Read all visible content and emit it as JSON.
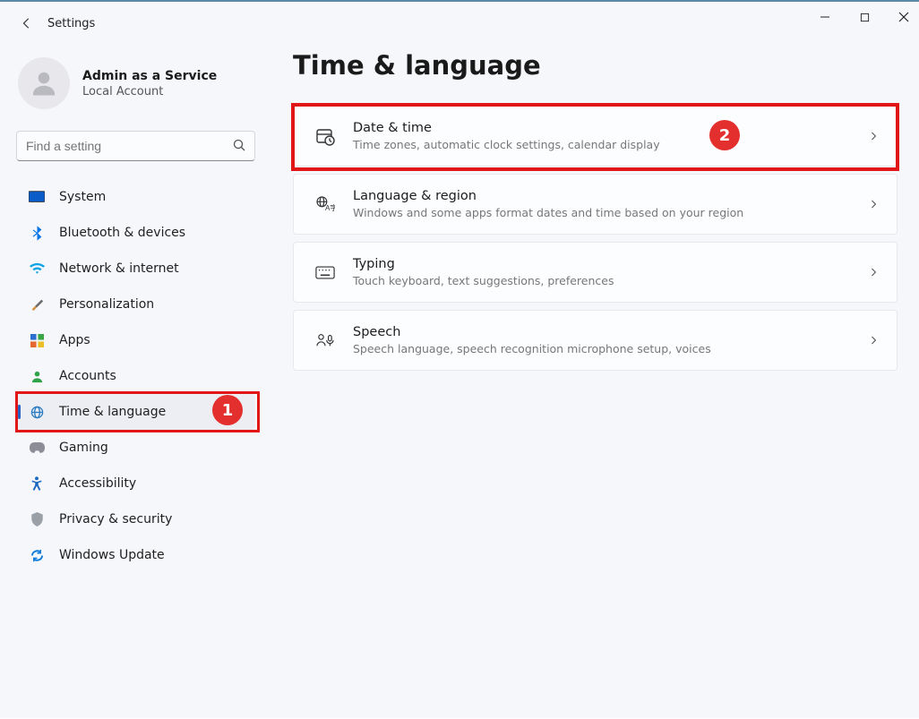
{
  "titlebar": {
    "label": "Settings"
  },
  "user": {
    "name": "Admin as a Service",
    "sub": "Local Account"
  },
  "search": {
    "placeholder": "Find a setting"
  },
  "nav": [
    {
      "key": "system",
      "label": "System",
      "icon": "system"
    },
    {
      "key": "bluetooth",
      "label": "Bluetooth & devices",
      "icon": "bt"
    },
    {
      "key": "network",
      "label": "Network & internet",
      "icon": "net"
    },
    {
      "key": "personal",
      "label": "Personalization",
      "icon": "brush"
    },
    {
      "key": "apps",
      "label": "Apps",
      "icon": "apps"
    },
    {
      "key": "accounts",
      "label": "Accounts",
      "icon": "account"
    },
    {
      "key": "time",
      "label": "Time & language",
      "icon": "globe",
      "selected": true
    },
    {
      "key": "gaming",
      "label": "Gaming",
      "icon": "game"
    },
    {
      "key": "access",
      "label": "Accessibility",
      "icon": "access"
    },
    {
      "key": "privacy",
      "label": "Privacy & security",
      "icon": "shield"
    },
    {
      "key": "update",
      "label": "Windows Update",
      "icon": "update"
    }
  ],
  "page": {
    "title": "Time & language"
  },
  "cards": [
    {
      "key": "datetime",
      "title": "Date & time",
      "sub": "Time zones, automatic clock settings, calendar display",
      "icon": "clock"
    },
    {
      "key": "lang",
      "title": "Language & region",
      "sub": "Windows and some apps format dates and time based on your region",
      "icon": "lang"
    },
    {
      "key": "typing",
      "title": "Typing",
      "sub": "Touch keyboard, text suggestions, preferences",
      "icon": "kbd"
    },
    {
      "key": "speech",
      "title": "Speech",
      "sub": "Speech language, speech recognition microphone setup, voices",
      "icon": "mic"
    }
  ],
  "callouts": {
    "one": "1",
    "two": "2"
  }
}
